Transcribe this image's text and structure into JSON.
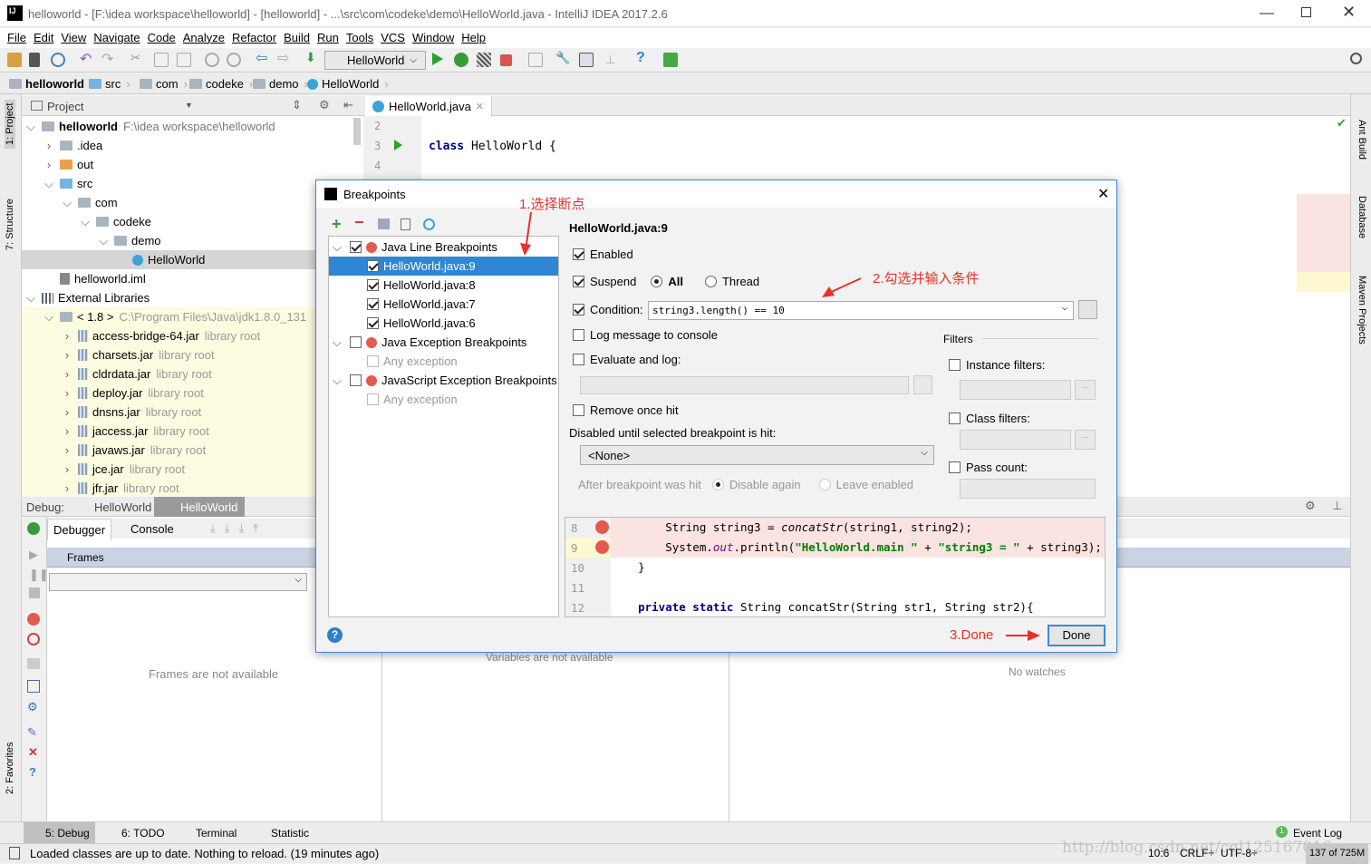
{
  "window": {
    "title": "helloworld - [F:\\idea workspace\\helloworld] - [helloworld] - ...\\src\\com\\codeke\\demo\\HelloWorld.java - IntelliJ IDEA 2017.2.6",
    "logo": "IJ"
  },
  "menu": [
    "File",
    "Edit",
    "View",
    "Navigate",
    "Code",
    "Analyze",
    "Refactor",
    "Build",
    "Run",
    "Tools",
    "VCS",
    "Window",
    "Help"
  ],
  "toolbar": {
    "run_config": "HelloWorld"
  },
  "breadcrumb": [
    "helloworld",
    "src",
    "com",
    "codeke",
    "demo",
    "HelloWorld"
  ],
  "left_stripe": [
    "1: Project",
    "7: Structure",
    "2: Favorites"
  ],
  "right_stripe": [
    "Ant Build",
    "Database",
    "Maven Projects"
  ],
  "project": {
    "header": "Project",
    "tree": [
      {
        "label": "helloworld",
        "extra": "F:\\idea workspace\\helloworld",
        "level": 0,
        "open": true,
        "bold": true,
        "icon": "module"
      },
      {
        "label": ".idea",
        "level": 1,
        "icon": "folder"
      },
      {
        "label": "out",
        "level": 1,
        "icon": "folder-orange"
      },
      {
        "label": "src",
        "level": 1,
        "open": true,
        "icon": "folder-blue"
      },
      {
        "label": "com",
        "level": 2,
        "open": true,
        "icon": "package"
      },
      {
        "label": "codeke",
        "level": 3,
        "open": true,
        "icon": "package"
      },
      {
        "label": "demo",
        "level": 4,
        "open": true,
        "icon": "package"
      },
      {
        "label": "HelloWorld",
        "level": 5,
        "leaf": true,
        "selected": true,
        "icon": "class"
      },
      {
        "label": "helloworld.iml",
        "level": 1,
        "leaf": true,
        "icon": "file"
      },
      {
        "label": "External Libraries",
        "level": 0,
        "open": true,
        "icon": "library"
      },
      {
        "label": "< 1.8 >",
        "extra": "C:\\Program Files\\Java\\jdk1.8.0_131",
        "level": 1,
        "open": true,
        "icon": "folder",
        "lib": true
      },
      {
        "label": "access-bridge-64.jar",
        "extra": "library root",
        "level": 2,
        "icon": "jar",
        "lib": true
      },
      {
        "label": "charsets.jar",
        "extra": "library root",
        "level": 2,
        "icon": "jar",
        "lib": true
      },
      {
        "label": "cldrdata.jar",
        "extra": "library root",
        "level": 2,
        "icon": "jar",
        "lib": true
      },
      {
        "label": "deploy.jar",
        "extra": "library root",
        "level": 2,
        "icon": "jar",
        "lib": true
      },
      {
        "label": "dnsns.jar",
        "extra": "library root",
        "level": 2,
        "icon": "jar",
        "lib": true
      },
      {
        "label": "jaccess.jar",
        "extra": "library root",
        "level": 2,
        "icon": "jar",
        "lib": true
      },
      {
        "label": "javaws.jar",
        "extra": "library root",
        "level": 2,
        "icon": "jar",
        "lib": true
      },
      {
        "label": "jce.jar",
        "extra": "library root",
        "level": 2,
        "icon": "jar",
        "lib": true
      },
      {
        "label": "jfr.jar",
        "extra": "library root",
        "level": 2,
        "icon": "jar",
        "lib": true
      }
    ]
  },
  "editor": {
    "tab": "HelloWorld.java",
    "lines": [
      {
        "n": "2",
        "code": ""
      },
      {
        "n": "3",
        "code": "class HelloWorld {"
      },
      {
        "n": "4",
        "code": ""
      }
    ]
  },
  "debug": {
    "label": "Debug:",
    "tabs": [
      "HelloWorld",
      "HelloWorld"
    ],
    "subtabs": [
      "Debugger",
      "Console"
    ],
    "frames_header": "Frames",
    "frames_empty": "Frames are not available",
    "variables_empty": "Variables are not available",
    "watches_empty": "No watches"
  },
  "dialog": {
    "title": "Breakpoints",
    "tree": [
      {
        "label": "Java Line Breakpoints",
        "level": 0,
        "checked": true,
        "group": true
      },
      {
        "label": "HelloWorld.java:9",
        "level": 1,
        "checked": true,
        "selected": true
      },
      {
        "label": "HelloWorld.java:8",
        "level": 1,
        "checked": true
      },
      {
        "label": "HelloWorld.java:7",
        "level": 1,
        "checked": true
      },
      {
        "label": "HelloWorld.java:6",
        "level": 1,
        "checked": true
      },
      {
        "label": "Java Exception Breakpoints",
        "level": 0,
        "checked": false,
        "group": true
      },
      {
        "label": "Any exception",
        "level": 1,
        "checked": false,
        "disabled": true
      },
      {
        "label": "JavaScript Exception Breakpoints",
        "level": 0,
        "checked": false,
        "group": true
      },
      {
        "label": "Any exception",
        "level": 1,
        "checked": false,
        "disabled": true
      }
    ],
    "heading": "HelloWorld.java:9",
    "enabled": {
      "label": "Enabled",
      "checked": true
    },
    "suspend": {
      "label": "Suspend",
      "checked": true,
      "all": "All",
      "thread": "Thread",
      "selected": "All"
    },
    "condition": {
      "label": "Condition:",
      "checked": true,
      "value": "string3.length() == 10"
    },
    "log_message": {
      "label": "Log message to console",
      "checked": false
    },
    "evaluate_log": {
      "label": "Evaluate and log:",
      "checked": false
    },
    "remove_once_hit": {
      "label": "Remove once hit",
      "checked": false
    },
    "disabled_until": {
      "label": "Disabled until selected breakpoint is hit:",
      "value": "<None>"
    },
    "after_hit": {
      "label": "After breakpoint was hit",
      "disable_again": "Disable again",
      "leave_enabled": "Leave enabled"
    },
    "filters": {
      "title": "Filters",
      "instance": "Instance filters:",
      "class": "Class filters:",
      "pass_count": "Pass count:"
    },
    "preview": [
      {
        "n": "8",
        "bp": true
      },
      {
        "n": "9",
        "bp": true
      },
      {
        "n": "10"
      },
      {
        "n": "11"
      },
      {
        "n": "12"
      }
    ],
    "done": "Done"
  },
  "annotations": {
    "a1": "1.选择断点",
    "a2": "2.勾选并输入条件",
    "a3": "3.Done",
    "color": "#e8312a"
  },
  "bottom_tools": [
    "5: Debug",
    "6: TODO",
    "Terminal",
    "Statistic"
  ],
  "event_log": {
    "count": "1",
    "label": "Event Log"
  },
  "status": {
    "message": "Loaded classes are up to date. Nothing to reload. (19 minutes ago)",
    "position": "10:6",
    "line_sep": "CRLF÷",
    "encoding": "UTF-8÷",
    "memory": "137 of 725M"
  },
  "watermark": "http://blog.csdn.net/cgl125167016"
}
